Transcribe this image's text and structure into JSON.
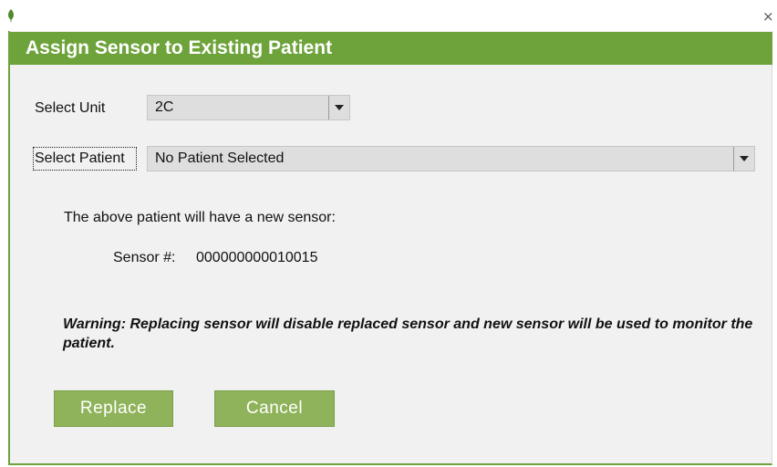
{
  "window": {
    "close_glyph": "×",
    "title": "Assign Sensor to Existing Patient",
    "app_icon": "leaf-icon",
    "accent_color": "#6da33a",
    "button_color": "#8fb35a"
  },
  "form": {
    "unit_label": "Select Unit",
    "unit_value": "2C",
    "patient_label": "Select Patient",
    "patient_value": "No Patient Selected"
  },
  "info": {
    "message": "The above patient will have a new sensor:",
    "sensor_label": "Sensor #:",
    "sensor_number": "000000000010015"
  },
  "warning": {
    "text": "Warning: Replacing sensor will disable replaced sensor and new sensor will be used to monitor the patient."
  },
  "buttons": {
    "replace": "Replace",
    "cancel": "Cancel"
  }
}
